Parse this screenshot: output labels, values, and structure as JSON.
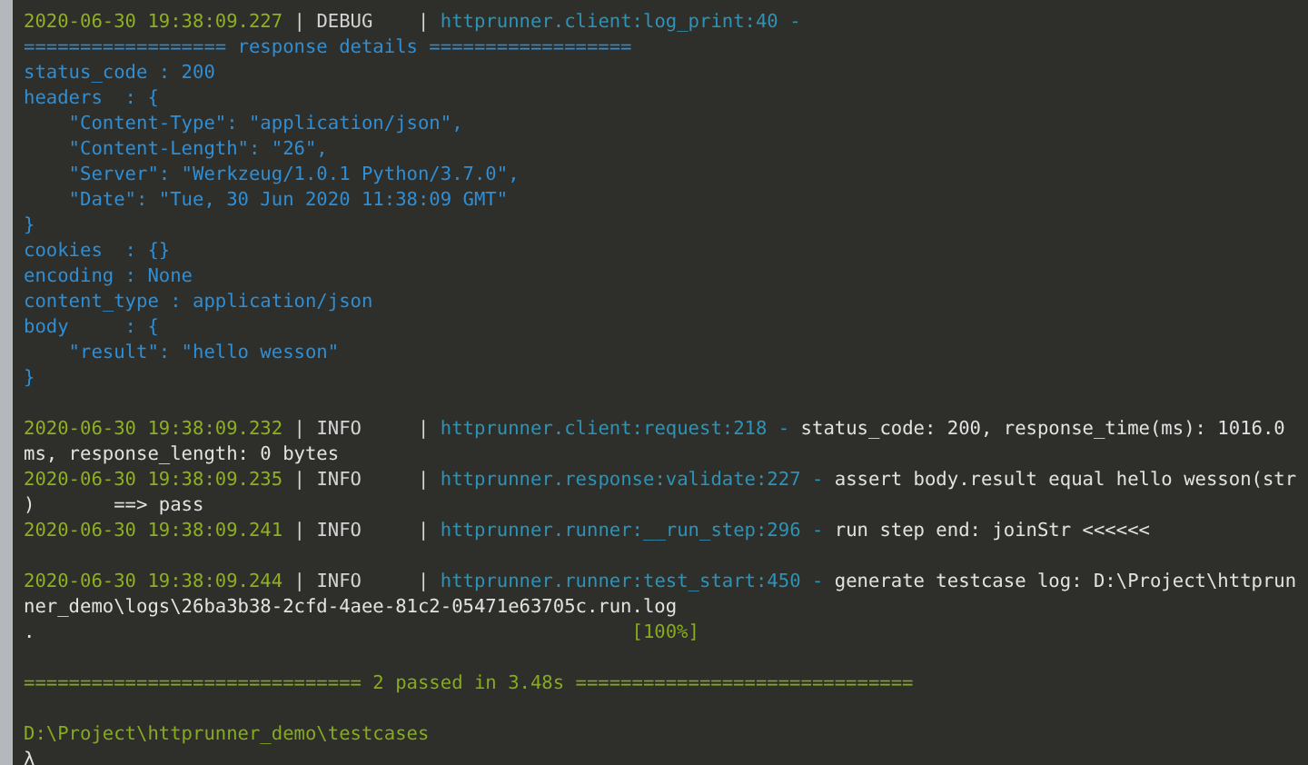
{
  "terminal": {
    "lines": [
      {
        "kind": "log",
        "parts": [
          {
            "kind": "time",
            "text": "2020-06-30 19:38:09.227"
          },
          {
            "kind": "level",
            "text": "| DEBUG    |"
          },
          {
            "kind": "source",
            "text": "httprunner.client:log_print:40 -"
          }
        ]
      },
      {
        "kind": "detail",
        "text": "================== response details =================="
      },
      {
        "kind": "detail",
        "text": "status_code : 200"
      },
      {
        "kind": "detail",
        "text": "headers  : {"
      },
      {
        "kind": "detail",
        "text": "    \"Content-Type\": \"application/json\","
      },
      {
        "kind": "detail",
        "text": "    \"Content-Length\": \"26\","
      },
      {
        "kind": "detail",
        "text": "    \"Server\": \"Werkzeug/1.0.1 Python/3.7.0\","
      },
      {
        "kind": "detail",
        "text": "    \"Date\": \"Tue, 30 Jun 2020 11:38:09 GMT\""
      },
      {
        "kind": "detail",
        "text": "}"
      },
      {
        "kind": "detail",
        "text": "cookies  : {}"
      },
      {
        "kind": "detail",
        "text": "encoding : None"
      },
      {
        "kind": "detail",
        "text": "content_type : application/json"
      },
      {
        "kind": "detail",
        "text": "body     : {"
      },
      {
        "kind": "detail",
        "text": "    \"result\": \"hello wesson\""
      },
      {
        "kind": "detail",
        "text": "}"
      },
      {
        "kind": "blank"
      },
      {
        "kind": "log",
        "parts": [
          {
            "kind": "time",
            "text": "2020-06-30 19:38:09.232"
          },
          {
            "kind": "level",
            "text": "| INFO     |"
          },
          {
            "kind": "source",
            "text": "httprunner.client:request:218 -"
          },
          {
            "kind": "message",
            "text": "status_code: 200, response_time(ms): 1016.0"
          }
        ]
      },
      {
        "kind": "plain",
        "text": "ms, response_length: 0 bytes"
      },
      {
        "kind": "log",
        "parts": [
          {
            "kind": "time",
            "text": "2020-06-30 19:38:09.235"
          },
          {
            "kind": "level",
            "text": "| INFO     |"
          },
          {
            "kind": "source",
            "text": "httprunner.response:validate:227 -"
          },
          {
            "kind": "message",
            "text": "assert body.result equal hello wesson(str"
          }
        ]
      },
      {
        "kind": "plain",
        "text": ")       ==> pass"
      },
      {
        "kind": "log",
        "parts": [
          {
            "kind": "time",
            "text": "2020-06-30 19:38:09.241"
          },
          {
            "kind": "level",
            "text": "| INFO     |"
          },
          {
            "kind": "source",
            "text": "httprunner.runner:__run_step:296 -"
          },
          {
            "kind": "message",
            "text": "run step end: joinStr <<<<<<"
          }
        ]
      },
      {
        "kind": "blank"
      },
      {
        "kind": "log",
        "parts": [
          {
            "kind": "time",
            "text": "2020-06-30 19:38:09.244"
          },
          {
            "kind": "level",
            "text": "| INFO     |"
          },
          {
            "kind": "source",
            "text": "httprunner.runner:test_start:450 -"
          },
          {
            "kind": "message",
            "text": "generate testcase log: D:\\Project\\httprun"
          }
        ]
      },
      {
        "kind": "plain",
        "text": "ner_demo\\logs\\26ba3b38-2cfd-4aee-81c2-05471e63705c.run.log"
      },
      {
        "kind": "progress",
        "text": ".",
        "badge": "[100%]"
      },
      {
        "kind": "blank"
      },
      {
        "kind": "summary",
        "text": "============================== 2 passed in 3.48s =============================="
      },
      {
        "kind": "blank"
      },
      {
        "kind": "summary",
        "text": "D:\\Project\\httprunner_demo\\testcases"
      },
      {
        "kind": "plain",
        "text": "λ"
      }
    ]
  }
}
